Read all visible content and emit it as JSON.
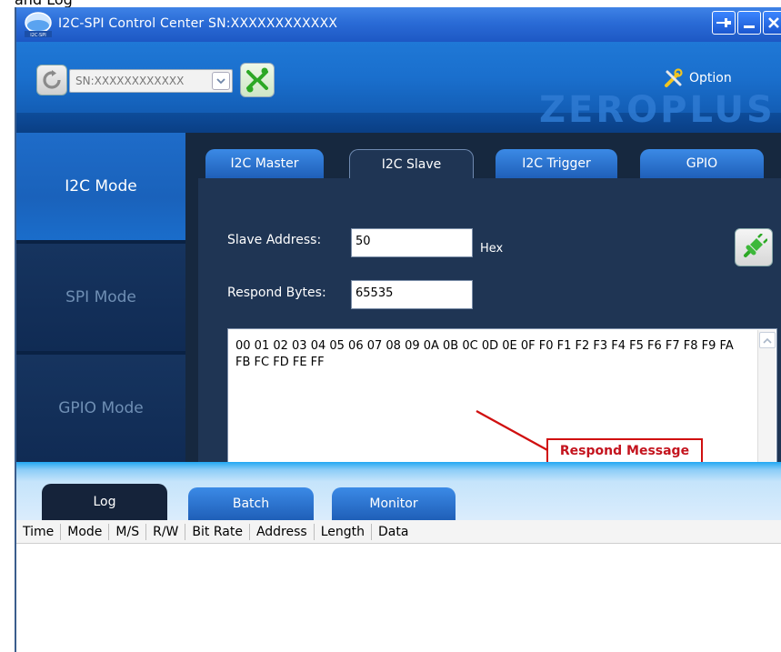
{
  "clipped_text": "and Log",
  "window": {
    "title": "I2C-SPI Control Center SN:XXXXXXXXXXXX"
  },
  "header": {
    "sn_select_value": "SN:XXXXXXXXXXXX",
    "option_label": "Option",
    "brand_logo": "ZEROPLUS"
  },
  "modes": [
    {
      "label": "I2C Mode",
      "active": true
    },
    {
      "label": "SPI Mode",
      "active": false
    },
    {
      "label": "GPIO Mode",
      "active": false
    }
  ],
  "tabs": [
    {
      "label": "I2C Master"
    },
    {
      "label": "I2C Slave",
      "active": true
    },
    {
      "label": "I2C Trigger"
    },
    {
      "label": "GPIO"
    }
  ],
  "form": {
    "slave_address_label": "Slave Address:",
    "slave_address_value": "50",
    "hex_label": "Hex",
    "respond_bytes_label": "Respond Bytes:",
    "respond_bytes_value": "65535",
    "respond_data": "00 01 02 03 04 05 06 07 08 09 0A 0B 0C 0D 0E 0F F0 F1 F2 F3 F4 F5 F6 F7 F8 F9 FA FB FC FD FE FF"
  },
  "annotation": {
    "label": "Respond Message",
    "color": "#c4141e"
  },
  "bottom_tabs": [
    {
      "label": "Log",
      "active": true
    },
    {
      "label": "Batch"
    },
    {
      "label": "Monitor"
    }
  ],
  "log_columns": [
    "Time",
    "Mode",
    "M/S",
    "R/W",
    "Bit Rate",
    "Address",
    "Length",
    "Data"
  ],
  "colors": {
    "title_bar": "#2a6bd6",
    "header": "#1a6fcd",
    "sidebar_dark": "#102b54",
    "panel": "#1f3554",
    "accent_green": "#3db83a"
  }
}
